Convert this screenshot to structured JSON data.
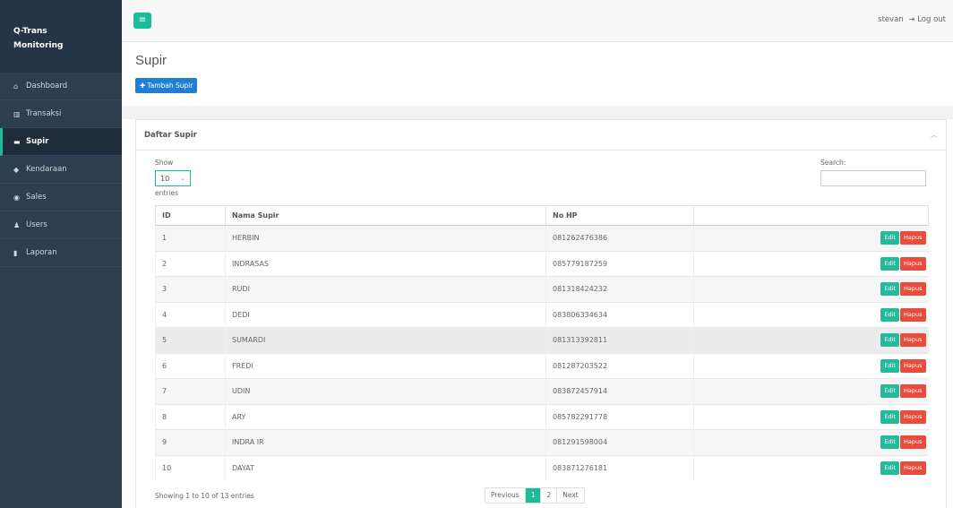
{
  "sidebar": {
    "brand_line1": "Q-Trans",
    "brand_line2": "Monitoring",
    "items": [
      {
        "label": "Dashboard",
        "icon": "home-icon"
      },
      {
        "label": "Transaksi",
        "icon": "bar-chart-icon"
      },
      {
        "label": "Supir",
        "icon": "id-card-icon"
      },
      {
        "label": "Kendaraan",
        "icon": "car-icon"
      },
      {
        "label": "Sales",
        "icon": "user-circle-icon"
      },
      {
        "label": "Users",
        "icon": "user-icon"
      },
      {
        "label": "Laporan",
        "icon": "file-icon"
      }
    ],
    "active": "Supir"
  },
  "topbar": {
    "menu_toggle_icon": "hamburger-icon",
    "username": "stevan",
    "logout_label": "Log out"
  },
  "page": {
    "title": "Supir",
    "add_button": "Tambah Supir"
  },
  "panel": {
    "title": "Daftar Supir",
    "show_label": "Show",
    "page_length": "10",
    "entries_label": "entries",
    "search_label": "Search:"
  },
  "table": {
    "columns": [
      "ID",
      "Nama Supir",
      "No HP",
      ""
    ],
    "rows": [
      {
        "id": "1",
        "name": "HERBIN",
        "phone": "081262476386"
      },
      {
        "id": "2",
        "name": "INDRASAS",
        "phone": "085779187259"
      },
      {
        "id": "3",
        "name": "RUDI",
        "phone": "081318424232"
      },
      {
        "id": "4",
        "name": "DEDI",
        "phone": "083806334634"
      },
      {
        "id": "5",
        "name": "SUMARDI",
        "phone": "081313392811"
      },
      {
        "id": "6",
        "name": "FREDI",
        "phone": "081287203522"
      },
      {
        "id": "7",
        "name": "UDIN",
        "phone": "083872457914"
      },
      {
        "id": "8",
        "name": "ARY",
        "phone": "085782291778"
      },
      {
        "id": "9",
        "name": "INDRA IR",
        "phone": "081291598004"
      },
      {
        "id": "10",
        "name": "DAYAT",
        "phone": "083871276181"
      }
    ],
    "edit_label": "Edit",
    "delete_label": "Hapus"
  },
  "footer": {
    "info": "Showing 1 to 10 of 13 entries",
    "previous": "Previous",
    "pages": [
      "1",
      "2"
    ],
    "current_page": "1",
    "next": "Next"
  },
  "colors": {
    "sidebar_bg": "#2c3e50",
    "accent": "#1abc9c",
    "primary": "#1f7fd3",
    "danger": "#e74c3c"
  }
}
